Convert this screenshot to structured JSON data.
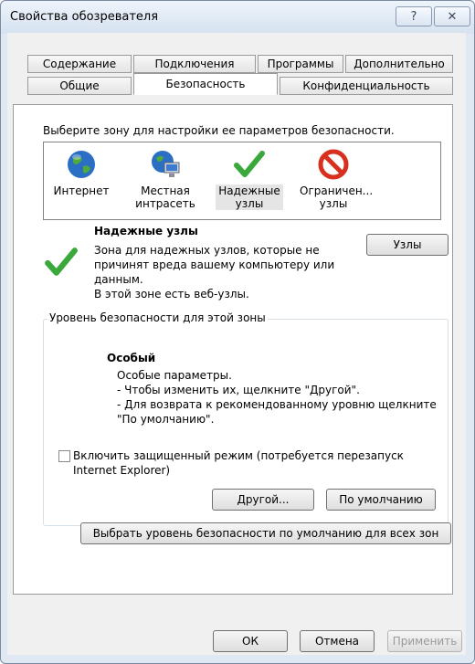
{
  "window": {
    "title": "Свойства обозревателя"
  },
  "titlebar": {
    "help_glyph": "?",
    "close_glyph": "✕"
  },
  "tabs": {
    "row1": [
      "Содержание",
      "Подключения",
      "Программы",
      "Дополнительно"
    ],
    "row2": [
      "Общие",
      "Безопасность",
      "Конфиденциальность"
    ]
  },
  "zone_prompt": "Выберите зону для настройки ее параметров безопасности.",
  "zones": [
    {
      "name_l1": "Интернет",
      "name_l2": "",
      "icon": "globe-icon"
    },
    {
      "name_l1": "Местная",
      "name_l2": "интрасеть",
      "icon": "intranet-icon"
    },
    {
      "name_l1": "Надежные",
      "name_l2": "узлы",
      "icon": "checkmark-icon"
    },
    {
      "name_l1": "Ограничен...",
      "name_l2": "узлы",
      "icon": "restricted-icon"
    }
  ],
  "zone_info": {
    "title": "Надежные узлы",
    "desc": [
      "Зона для надежных узлов, которые не",
      "причинят вреда вашему компьютеру или",
      "данным.",
      "В этой зоне есть веб-узлы."
    ],
    "sites_button": "Узлы"
  },
  "level": {
    "group_label": "Уровень безопасности для этой зоны",
    "name": "Особый",
    "desc": [
      "Особые параметры.",
      "- Чтобы изменить их, щелкните \"Другой\".",
      "- Для возврата к рекомендованному уровню щелкните",
      "\"По умолчанию\"."
    ],
    "protected_mode_l1": "Включить защищенный режим (потребуется перезапуск",
    "protected_mode_l2": "Internet Explorer)",
    "protected_mode_checked": false,
    "custom_button": "Другой...",
    "default_button": "По умолчанию"
  },
  "reset_all_button": "Выбрать уровень безопасности по умолчанию для всех зон",
  "footer": {
    "ok": "ОК",
    "cancel": "Отмена",
    "apply": "Применить"
  },
  "colors": {
    "check_green": "#3aa83a",
    "restricted_red": "#d8301e",
    "globe_blue": "#2a6fc4"
  }
}
